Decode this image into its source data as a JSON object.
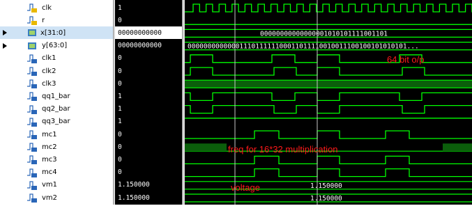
{
  "signals": [
    {
      "name": "clk",
      "value": "1",
      "icon": "bit-icon-yellow",
      "expandable": false
    },
    {
      "name": "r",
      "value": "0",
      "icon": "bit-icon-yellow",
      "expandable": false
    },
    {
      "name": "x[31:0]",
      "value": "00000000000",
      "icon": "bus-icon",
      "expandable": true,
      "selected": true
    },
    {
      "name": "y[63:0]",
      "value": "00000000000",
      "icon": "bus-icon",
      "expandable": true
    },
    {
      "name": "clk1",
      "value": "0",
      "icon": "bit-icon-blue",
      "expandable": false
    },
    {
      "name": "clk2",
      "value": "0",
      "icon": "bit-icon-blue",
      "expandable": false
    },
    {
      "name": "clk3",
      "value": "0",
      "icon": "bit-icon-blue",
      "expandable": false
    },
    {
      "name": "qq1_bar",
      "value": "1",
      "icon": "bit-icon-blue",
      "expandable": false
    },
    {
      "name": "qq2_bar",
      "value": "1",
      "icon": "bit-icon-blue",
      "expandable": false
    },
    {
      "name": "qq3_bar",
      "value": "1",
      "icon": "bit-icon-blue",
      "expandable": false
    },
    {
      "name": "mc1",
      "value": "0",
      "icon": "bit-icon-blue",
      "expandable": false
    },
    {
      "name": "mc2",
      "value": "0",
      "icon": "bit-icon-blue",
      "expandable": false
    },
    {
      "name": "mc3",
      "value": "0",
      "icon": "bit-icon-blue",
      "expandable": false
    },
    {
      "name": "mc4",
      "value": "0",
      "icon": "bit-icon-blue",
      "expandable": false
    },
    {
      "name": "vm1",
      "value": "1.150000",
      "icon": "bit-icon-blue",
      "expandable": false
    },
    {
      "name": "vm2",
      "value": "1.150000",
      "icon": "bit-icon-blue",
      "expandable": false
    }
  ],
  "waveforms": {
    "x_bus_value": "00000000000000001010101111001101",
    "y_bus_value": "0000000000000111011111100011011110010011100100101010101...",
    "vm1_value": "1.150000",
    "vm2_value": "1.150000"
  },
  "annotations": {
    "output": "64 bit o/p",
    "freq": "freq for 16*32 multiplication",
    "voltage": "voltage"
  },
  "colors": {
    "wave": "#00ff00",
    "annotation": "#ff1a1a",
    "background": "#000000",
    "cursor": "#c8c8c8"
  }
}
